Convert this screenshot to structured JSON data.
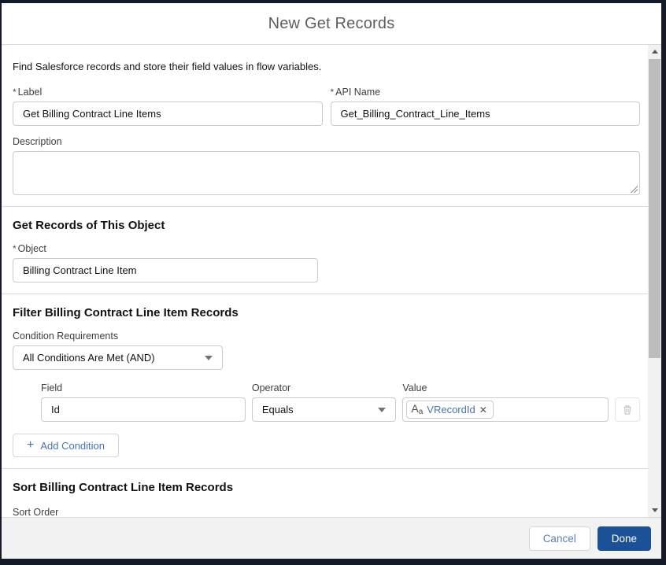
{
  "ui": {
    "required_marker": "*"
  },
  "modal": {
    "title": "New Get Records",
    "intro": "Find Salesforce records and store their field values in flow variables."
  },
  "fields": {
    "label": {
      "label": "Label",
      "value": "Get Billing Contract Line Items"
    },
    "api_name": {
      "label": "API Name",
      "value": "Get_Billing_Contract_Line_Items"
    },
    "description": {
      "label": "Description",
      "value": ""
    },
    "object": {
      "label": "Object",
      "value": "Billing Contract Line Item"
    }
  },
  "sections": {
    "object_title": "Get Records of This Object",
    "filter_title": "Filter Billing Contract Line Item Records",
    "sort_title": "Sort Billing Contract Line Item Records"
  },
  "filter": {
    "condition_requirements_label": "Condition Requirements",
    "condition_requirements_value": "All Conditions Are Met (AND)",
    "condition_row": {
      "field_label": "Field",
      "field_value": "Id",
      "operator_label": "Operator",
      "operator_value": "Equals",
      "value_label": "Value",
      "value_pill_text": "VRecordId",
      "value_pill_icon": "Aa",
      "remove_pill_glyph": "✕"
    },
    "add_condition_label": "Add Condition",
    "add_condition_glyph": "+"
  },
  "sort": {
    "sort_order_label": "Sort Order"
  },
  "footer": {
    "cancel_label": "Cancel",
    "done_label": "Done"
  },
  "colors": {
    "brand_button": "#1b5297",
    "link_blue": "#4a74ad",
    "border_gray": "#cdcbc9",
    "footer_bg": "#f3f2f2",
    "backdrop_dark": "#141b27"
  }
}
